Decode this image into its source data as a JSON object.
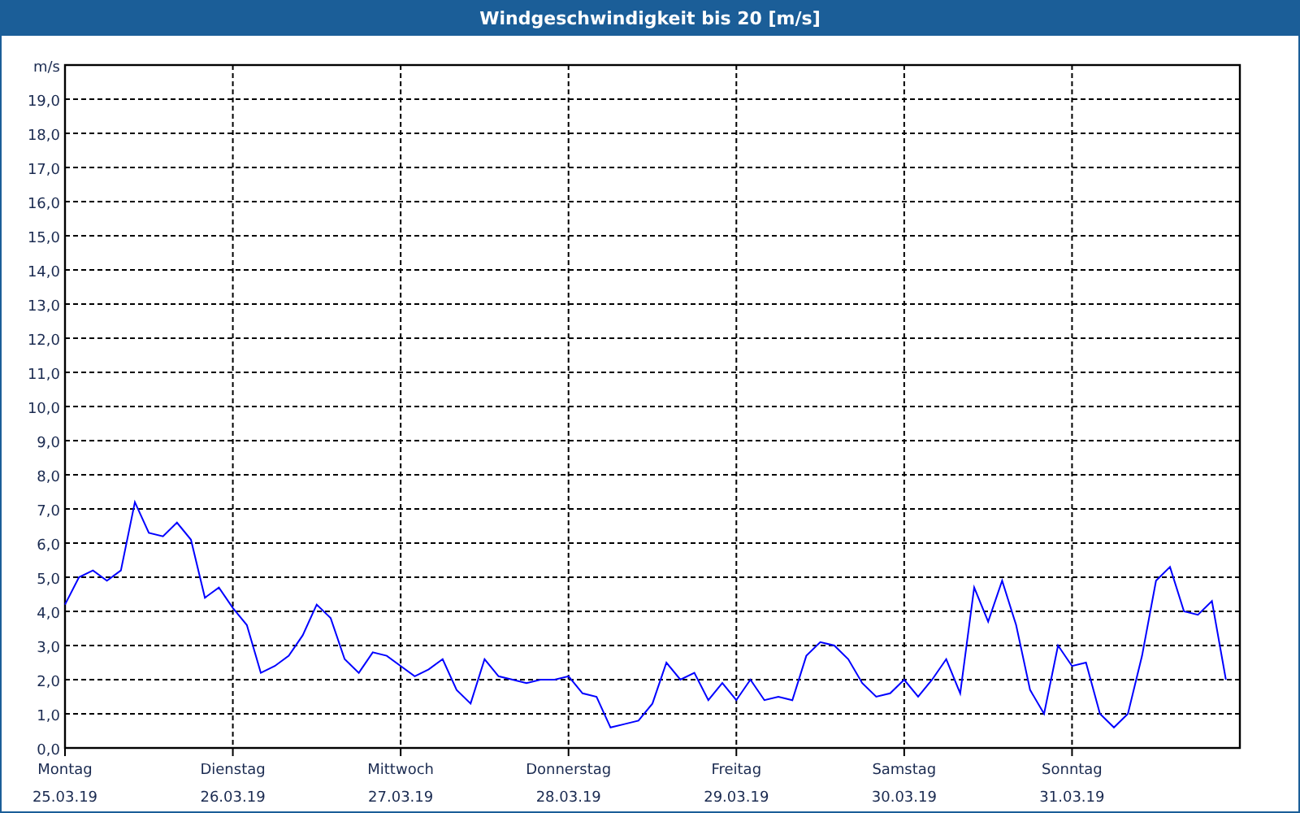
{
  "window": {
    "title": "Windgeschwindigkeit bis 20 [m/s]"
  },
  "chart": {
    "dates": [
      "25.03.19",
      "26.03.19",
      "27.03.19",
      "28.03.19",
      "29.03.19",
      "30.03.19",
      "31.03.19"
    ],
    "chart_data": {
      "type": "line",
      "ylabel": "m/s",
      "categories": [
        "Montag",
        null,
        null,
        null,
        null,
        null,
        null,
        null,
        null,
        null,
        null,
        null,
        "Dienstag",
        null,
        null,
        null,
        null,
        null,
        null,
        null,
        null,
        null,
        null,
        null,
        "Mittwoch",
        null,
        null,
        null,
        null,
        null,
        null,
        null,
        null,
        null,
        null,
        null,
        "Donnerstag",
        null,
        null,
        null,
        null,
        null,
        null,
        null,
        null,
        null,
        null,
        null,
        "Freitag",
        null,
        null,
        null,
        null,
        null,
        null,
        null,
        null,
        null,
        null,
        null,
        "Samstag",
        null,
        null,
        null,
        null,
        null,
        null,
        null,
        null,
        null,
        null,
        null,
        "Sonntag",
        null,
        null,
        null,
        null,
        null,
        null,
        null,
        null,
        null,
        null,
        null
      ],
      "series": [
        {
          "color": "#0000ff",
          "values": [
            4.2,
            5.0,
            5.2,
            4.9,
            5.2,
            7.2,
            6.3,
            6.2,
            6.6,
            6.1,
            4.4,
            4.7,
            4.1,
            3.6,
            2.2,
            2.4,
            2.7,
            3.3,
            4.2,
            3.8,
            2.6,
            2.2,
            2.8,
            2.7,
            2.4,
            2.1,
            2.3,
            2.6,
            1.7,
            1.3,
            2.6,
            2.1,
            2.0,
            1.9,
            2.0,
            2.0,
            2.1,
            1.6,
            1.5,
            0.6,
            0.7,
            0.8,
            1.3,
            2.5,
            2.0,
            2.2,
            1.4,
            1.9,
            1.4,
            2.0,
            1.4,
            1.5,
            1.4,
            2.7,
            3.1,
            3.0,
            2.6,
            1.9,
            1.5,
            1.6,
            2.0,
            1.5,
            2.0,
            2.6,
            1.6,
            4.7,
            3.7,
            4.9,
            3.6,
            1.7,
            1.0,
            3.0,
            2.4,
            2.5,
            1.0,
            0.6,
            1.0,
            2.7,
            4.9,
            5.3,
            4.0,
            3.9,
            4.3,
            2.0
          ]
        }
      ],
      "ylim": [
        0,
        20
      ],
      "grid": true,
      "yticks": [
        {
          "value": 0,
          "label": "0,0"
        },
        {
          "value": 1,
          "label": "1,0"
        },
        {
          "value": 2,
          "label": "2,0"
        },
        {
          "value": 3,
          "label": "3,0"
        },
        {
          "value": 4,
          "label": "4,0"
        },
        {
          "value": 5,
          "label": "5,0"
        },
        {
          "value": 6,
          "label": "6,0"
        },
        {
          "value": 7,
          "label": "7,0"
        },
        {
          "value": 8,
          "label": "8,0"
        },
        {
          "value": 9,
          "label": "9,0"
        },
        {
          "value": 10,
          "label": "10,0"
        },
        {
          "value": 11,
          "label": "11,0"
        },
        {
          "value": 12,
          "label": "12,0"
        },
        {
          "value": 13,
          "label": "13,0"
        },
        {
          "value": 14,
          "label": "14,0"
        },
        {
          "value": 15,
          "label": "15,0"
        },
        {
          "value": 16,
          "label": "16,0"
        },
        {
          "value": 17,
          "label": "17,0"
        },
        {
          "value": 18,
          "label": "18,0"
        },
        {
          "value": 19,
          "label": "19,0"
        }
      ]
    }
  }
}
